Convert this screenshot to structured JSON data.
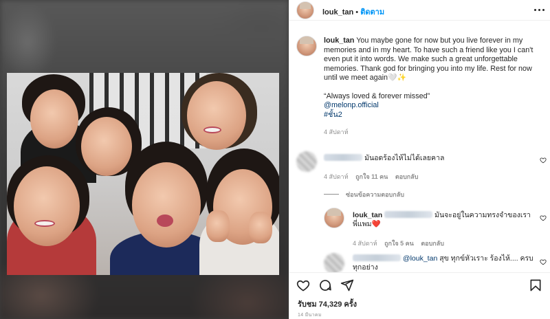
{
  "header": {
    "username": "louk_tan",
    "separator": "•",
    "follow_label": "ติดตาม"
  },
  "caption": {
    "username": "louk_tan",
    "text": "You maybe gone for now but you live forever in my memories and in my heart. To have such a friend like you I can't even put it into words. We make such a great unforgettable memories. Thank god for bringing you into my life. Rest for now until we meet again🤍✨",
    "quote": "“Always loved & forever missed”",
    "mention": "@melonp.official",
    "hashtag": "#ชั้น2",
    "time": "4 สัปดาห์"
  },
  "comments": [
    {
      "text": "มันอดร้องไห้ไม่ได้เลยคาล",
      "time": "4 สัปดาห์",
      "likes": "ถูกใจ 11 คน",
      "reply_label": "ตอบกลับ"
    }
  ],
  "hide_replies_label": "ซ่อนข้อความตอบกลับ",
  "reply": {
    "username": "louk_tan",
    "text_a": "มันจะอยู่ในความทรงจำของเรา",
    "text_b": "พี่แพม",
    "heart": "❤️",
    "time": "4 สัปดาห์",
    "likes": "ถูกใจ 5 คน",
    "reply_label": "ตอบกลับ"
  },
  "comment3": {
    "mention": "@louk_tan",
    "text": "สุข ทุกข์หัวเราะ ร้องไห้.... ครบ",
    "text_cont": "ทุกอย่าง"
  },
  "actions": {
    "likes_label": "รับชม 74,329 ครั้ง",
    "date": "14 มีนาคม"
  },
  "icons": [
    "more-icon",
    "heart-icon",
    "comment-icon",
    "share-icon",
    "bookmark-icon",
    "small-heart-icon"
  ],
  "colors": {
    "link": "#0095f6",
    "mention": "#00376b",
    "muted": "#8e8e8e",
    "heart_red": "#ed4956"
  }
}
